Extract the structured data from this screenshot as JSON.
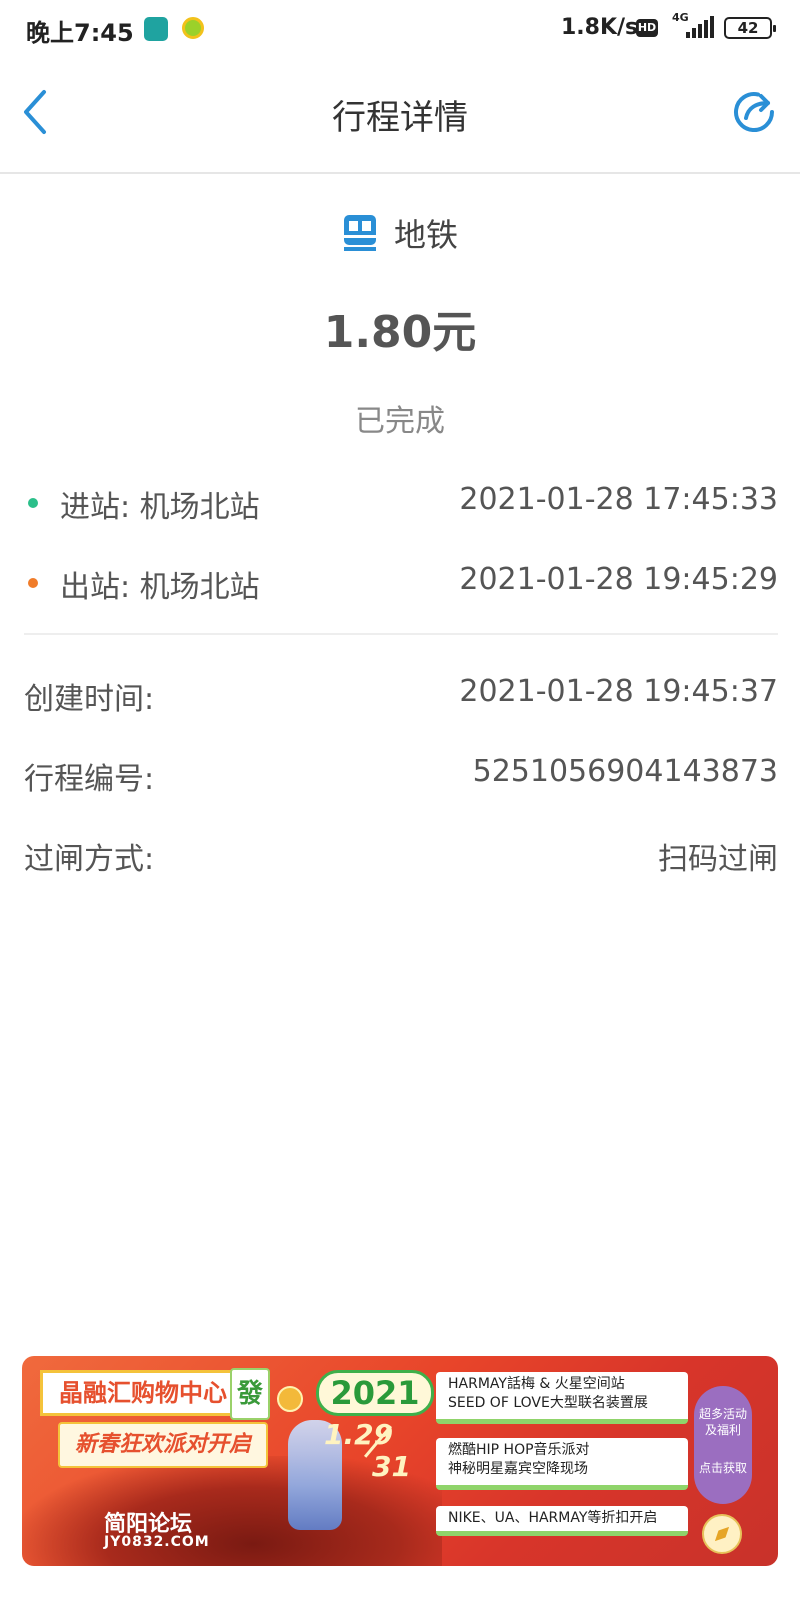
{
  "status_bar": {
    "time": "晚上7:45",
    "net_speed": "1.8K/s",
    "hd": "HD",
    "network": "4G",
    "battery": "42"
  },
  "nav": {
    "title": "行程详情",
    "back_icon": "chevron-left-icon",
    "share_icon": "share-icon"
  },
  "trip": {
    "mode_icon": "metro-icon",
    "mode": "地铁",
    "amount": "1.80元",
    "status": "已完成",
    "entry": {
      "label": "进站: 机场北站",
      "time": "2021-01-28 17:45:33",
      "color": "#2bbf8a"
    },
    "exit": {
      "label": "出站: 机场北站",
      "time": "2021-01-28 19:45:29",
      "color": "#f07c2a"
    }
  },
  "details": [
    {
      "label": "创建时间:",
      "value": "2021-01-28 19:45:37"
    },
    {
      "label": "行程编号:",
      "value": "5251056904143873"
    },
    {
      "label": "过闸方式:",
      "value": "扫码过闸"
    }
  ],
  "banner": {
    "mall": "晶融汇购物中心",
    "mahjong": "發",
    "party": "新春狂欢派对开启",
    "year": "2021",
    "date_start": "1.29",
    "date_end": "31",
    "card1_line1": "HARMAY話梅 & 火星空间站",
    "card1_line2": "SEED OF LOVE大型联名装置展",
    "card2_line1": "燃酷HIP HOP音乐派对",
    "card2_line2": "神秘明星嘉宾空降现场",
    "card3": "NIKE、UA、HARMAY等折扣开启",
    "more_line1": "超多活动",
    "more_line2": "及福利",
    "more_get": "点击获取",
    "forum": "简阳论坛",
    "domain": "JY0832.COM"
  }
}
